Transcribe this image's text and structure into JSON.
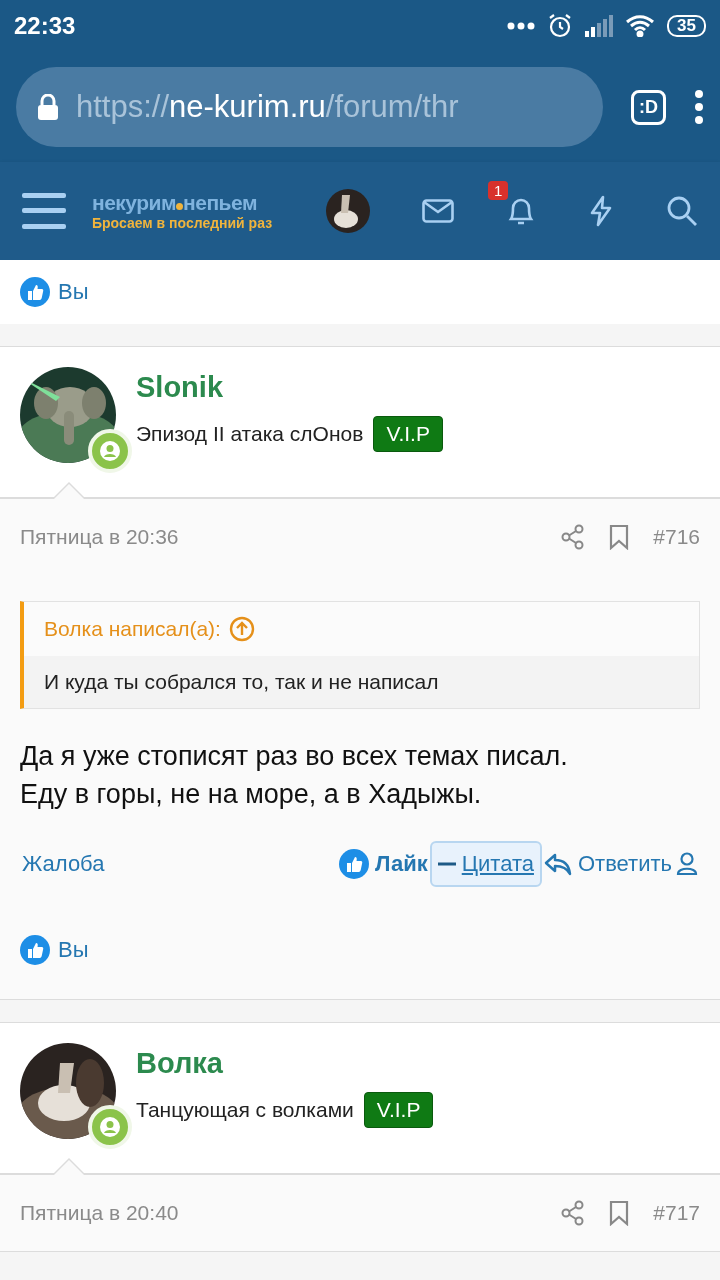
{
  "status_bar": {
    "time": "22:33",
    "battery": "35"
  },
  "browser": {
    "url_scheme": "https://",
    "url_domain": "ne-kurim.ru",
    "url_path": "/forum/thr",
    "tab_badge": ":D"
  },
  "site_header": {
    "logo_words": [
      "некурим",
      "непьем"
    ],
    "logo_tagline": "Бросаем в последний раз",
    "notification_count": "1"
  },
  "top_reactions": {
    "label": "Вы"
  },
  "posts": [
    {
      "author": "Slonik",
      "title": "Эпизод II атака слОнов",
      "badge": "V.I.P",
      "online": true,
      "date": "Пятница в 20:36",
      "number": "#716",
      "quote": {
        "author": "Волка написал(а):",
        "text": "И куда ты собрался то, так и не написал"
      },
      "body": [
        "Да я уже стописят раз во всех темах писал.",
        "Еду в горы, не на море, а в Хадыжы."
      ],
      "actions": [
        {
          "kind": "report",
          "label": "Жалоба",
          "active": false
        },
        {
          "kind": "like",
          "label": "Лайк",
          "active": false
        },
        {
          "kind": "quote",
          "label": "Цитата",
          "active": true
        },
        {
          "kind": "reply",
          "label": "Ответить",
          "active": false
        },
        {
          "kind": "profile",
          "active": false
        }
      ],
      "reactions": "Вы"
    },
    {
      "author": "Волка",
      "title": "Танцующая с волками",
      "badge": "V.I.P",
      "online": true,
      "date": "Пятница в 20:40",
      "number": "#717"
    }
  ]
}
